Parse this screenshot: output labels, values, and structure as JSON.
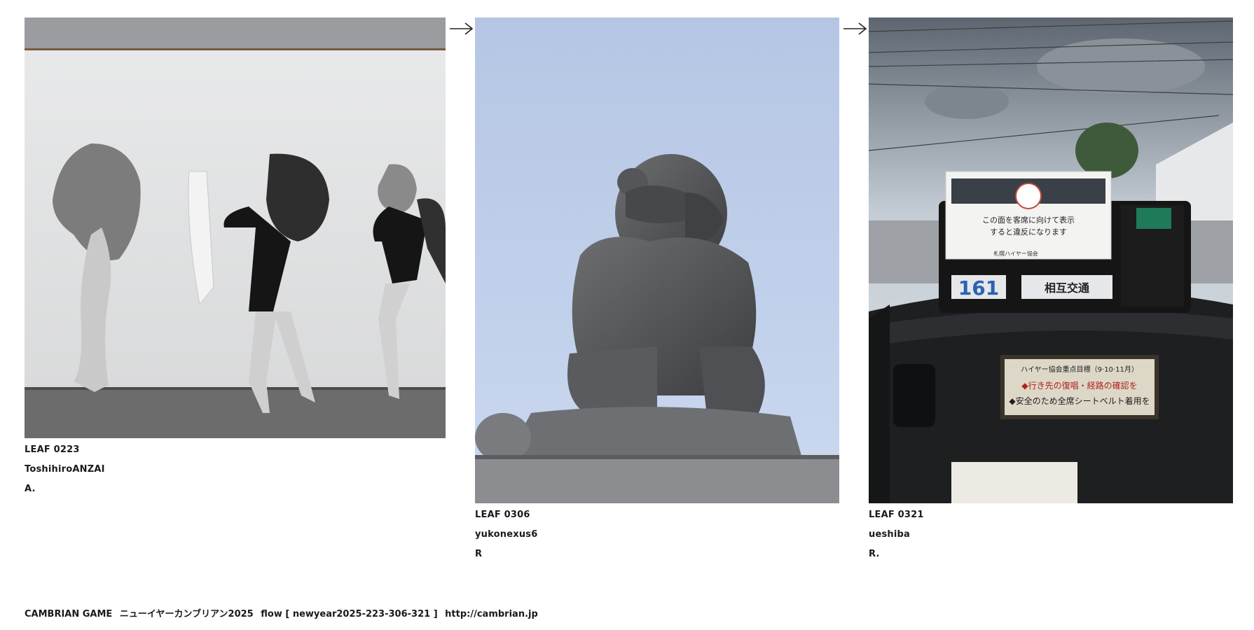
{
  "leaves": [
    {
      "leaf_id": "LEAF 0223",
      "author": "ToshihiroANZAI",
      "mark": "A."
    },
    {
      "leaf_id": "LEAF 0306",
      "author": "yukonexus6",
      "mark": "R"
    },
    {
      "leaf_id": "LEAF 0321",
      "author": "ueshiba",
      "mark": "R.",
      "photo_text": {
        "card_line1": "この面を客席に向けて表示",
        "card_line2": "すると違反になります",
        "card_assoc": "札幌ハイヤー協会",
        "plate_number": "161",
        "company": "相互交通",
        "dash_sign_title": "ハイヤー協会重点目標（9·10·11月）",
        "dash_sign_line1": "◆行き先の復唱・経路の確認を",
        "dash_sign_line2": "◆安全のため全席シートベルト着用を"
      }
    }
  ],
  "arrow_icon": "right-arrow-icon",
  "footer": {
    "site_name": "CAMBRIAN GAME",
    "event": "ニューイヤーカンブリアン2025",
    "flow": "flow [ newyear2025-223-306-321 ]",
    "url": "http://cambrian.jp"
  }
}
